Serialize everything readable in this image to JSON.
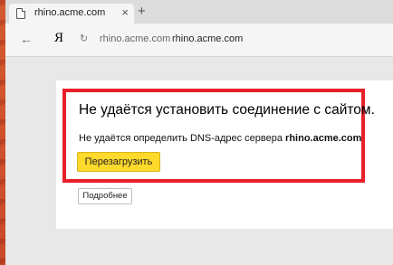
{
  "tab": {
    "title": "rhino.acme.com",
    "close_label": "×",
    "new_tab_label": "+"
  },
  "navbar": {
    "back_label": "←",
    "logo": "Я",
    "reload_label": "↻",
    "address_host": "rhino.acme.com",
    "address_url": "rhino.acme.com"
  },
  "error": {
    "title": "Не удаётся установить соединение с сайтом.",
    "message_prefix": "Не удаётся определить DNS-адрес сервера ",
    "message_host": "rhino.acme.com",
    "reload_button": "Перезагрузить",
    "details_button": "Подробнее"
  },
  "colors": {
    "highlight_border": "#e8202a",
    "reload_button_bg": "#ffd92b",
    "backdrop": "#c8462a"
  },
  "icons": [
    "page-icon",
    "close-icon",
    "new-tab-icon",
    "back-arrow-icon",
    "yandex-logo-icon",
    "reload-icon"
  ]
}
